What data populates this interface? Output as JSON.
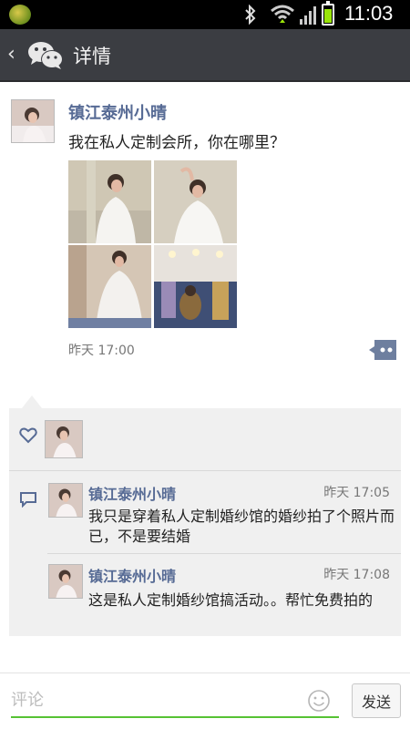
{
  "status_bar": {
    "time": "11:03",
    "icons": [
      "app-notification-icon",
      "bluetooth-icon",
      "wifi-icon",
      "signal-icon",
      "battery-icon"
    ],
    "battery_level": 0.85
  },
  "header": {
    "back_icon": "chevron-left-icon",
    "logo_icon": "wechat-icon",
    "title": "详情"
  },
  "post": {
    "author": "镇江泰州小晴",
    "text": "我在私人定制会所，你在哪里？",
    "photos": [
      "bride-photo-1",
      "bride-photo-2",
      "bride-photo-3",
      "wedding-shop-photo"
    ],
    "time": "昨天 17:00",
    "more_icon": "more-comment-icon"
  },
  "likes": {
    "icon": "heart-icon",
    "users": [
      "镇江泰州小晴"
    ]
  },
  "comments": {
    "icon": "comment-icon",
    "items": [
      {
        "author": "镇江泰州小晴",
        "time": "昨天 17:05",
        "text": "我只是穿着私人定制婚纱馆的婚纱拍了个照片而已，不是要结婚"
      },
      {
        "author": "镇江泰州小晴",
        "time": "昨天 17:08",
        "text": "这是私人定制婚纱馆搞活动。。帮忙免费拍的"
      }
    ]
  },
  "composer": {
    "placeholder": "评论",
    "value": "",
    "emoji_icon": "smiley-icon",
    "send_label": "发送"
  },
  "colors": {
    "titlebar": "#3b3d42",
    "name_link": "#576b95",
    "input_underline": "#56c234",
    "panel_bg": "#f0f0f0"
  }
}
